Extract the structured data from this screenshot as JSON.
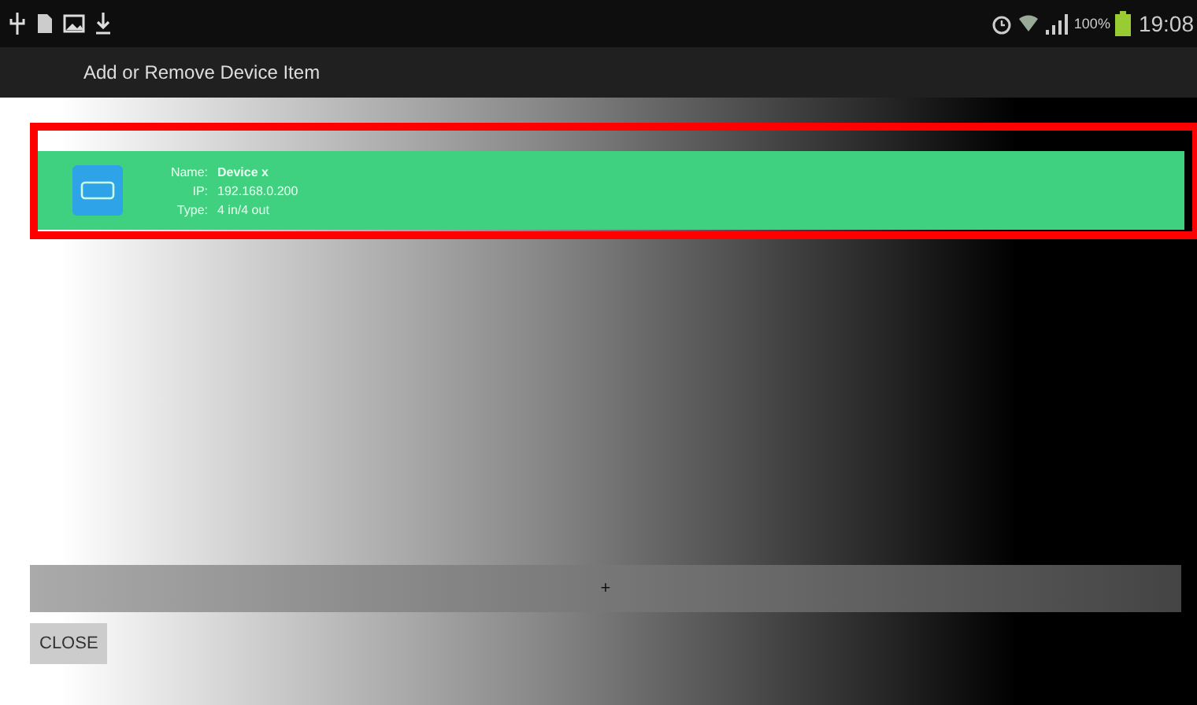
{
  "status_bar": {
    "battery": "100%",
    "time": "19:08"
  },
  "title": "Add or Remove Device Item",
  "devices": [
    {
      "fields": [
        {
          "label": "Name:",
          "value": "Device x",
          "kind": "name"
        },
        {
          "label": "IP:",
          "value": "192.168.0.200",
          "kind": "plain"
        },
        {
          "label": "Type:",
          "value": "4 in/4 out",
          "kind": "plain"
        }
      ],
      "highlighted": true
    }
  ],
  "add_button": "+",
  "close_button": "CLOSE"
}
